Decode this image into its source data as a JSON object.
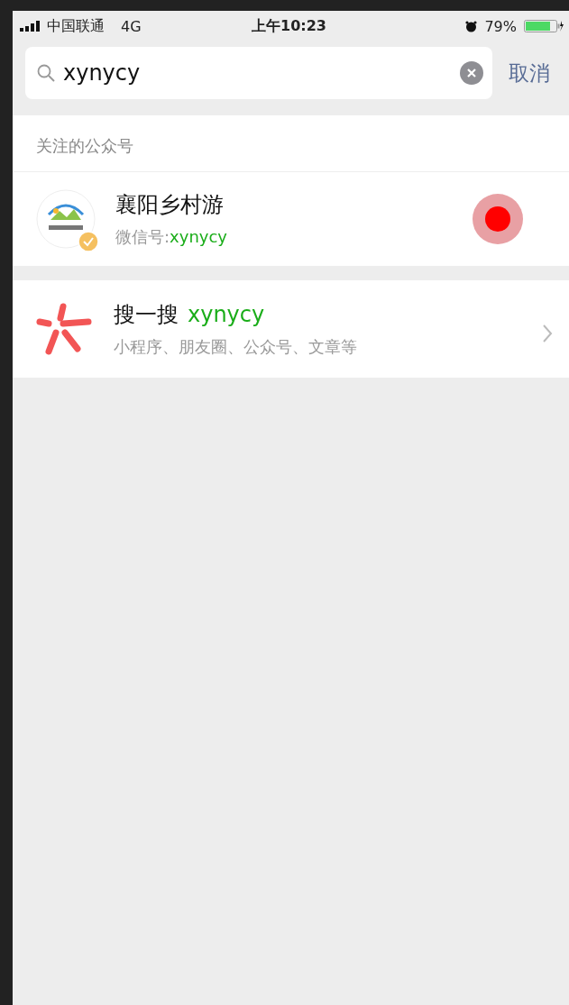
{
  "status_bar": {
    "carrier": "中国联通",
    "network": "4G",
    "time": "上午10:23",
    "battery": "79%"
  },
  "search": {
    "value": "xynycy",
    "cancel": "取消"
  },
  "section": {
    "title": "关注的公众号"
  },
  "accounts": [
    {
      "name": "襄阳乡村游",
      "id_label": "微信号:",
      "id": "xynycy",
      "verified": true
    }
  ],
  "search_everywhere": {
    "title": "搜一搜",
    "query": "xynycy",
    "subtitle": "小程序、朋友圈、公众号、文章等"
  }
}
